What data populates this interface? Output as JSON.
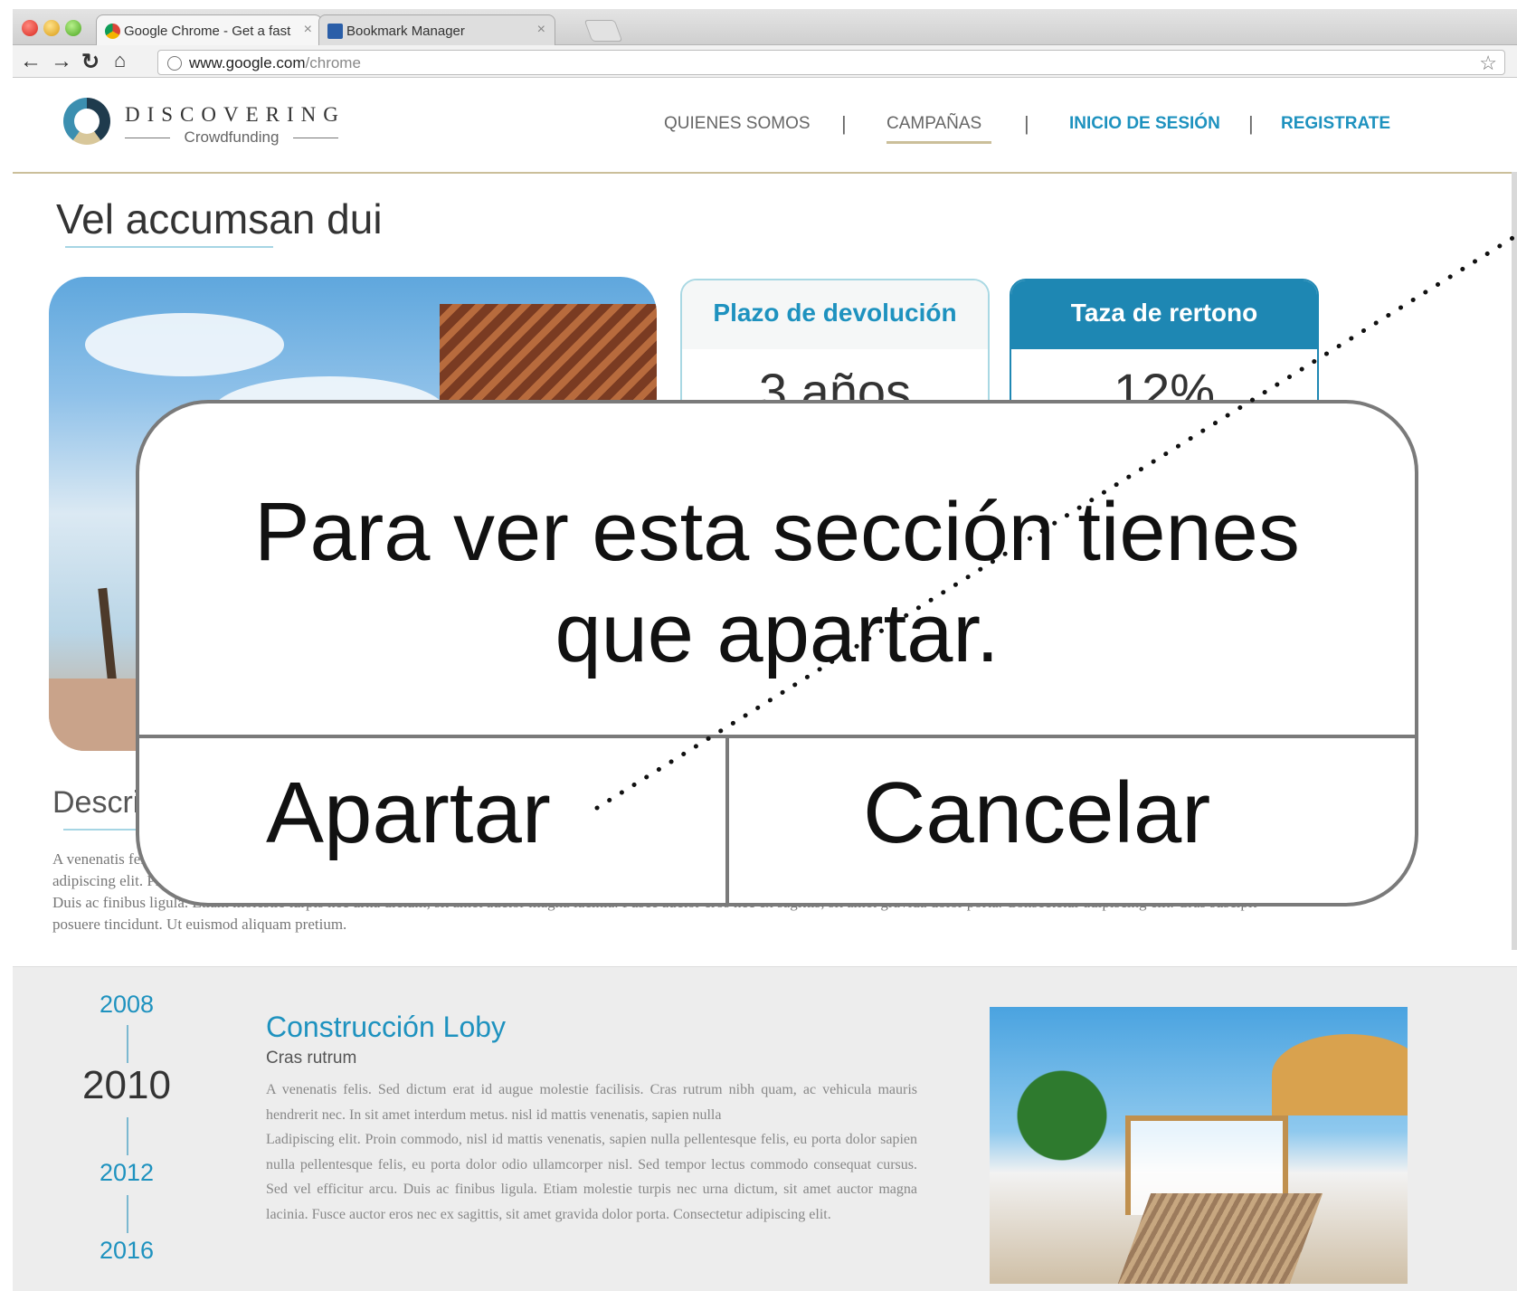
{
  "browser": {
    "tabs": [
      {
        "label": "Google Chrome - Get a fast",
        "active": true
      },
      {
        "label": "Bookmark Manager",
        "active": false
      }
    ],
    "url_host": "www.google.com",
    "url_path": "/chrome",
    "icons": {
      "back": "back-arrow-icon",
      "forward": "forward-arrow-icon",
      "reload": "reload-icon",
      "home": "home-icon",
      "bookmark": "star-icon"
    }
  },
  "header": {
    "logo_title": "DISCOVERING",
    "logo_subtitle": "Crowdfunding",
    "nav": {
      "quienes": "QUIENES SOMOS",
      "campanas": "CAMPAÑAS",
      "inicio": "INICIO DE SESIÓN",
      "registrate": "REGISTRATE"
    },
    "separator": "|"
  },
  "main": {
    "title": "Vel accumsan dui",
    "cards": {
      "plazo_title": "Plazo de devolución",
      "plazo_value": "3 años",
      "taza_title": "Taza de rertono",
      "taza_value": "12%"
    },
    "description_title": "Descripción",
    "description_text": "A venenatis felis. Sed dictum erat id augue molestie facilisis. Cras rutrum nibh quam, ac vehicula mauris hendrerit nec. In sit amet interdum metus. Lorem ipsum dolor sit amet, consectetur adipiscing elit. Proin commodo, nisl id mattis venenatis, sapien nulla pellentesque felis, eu porta dolor odio ullamcorper nisl. Sed tempor lectus commodo consequat cursus. Sed vel efficitur arcu. Duis ac finibus ligula. Etiam molestie turpis nec urna dictum, sit amet auctor magna lacinia. Fusce auctor eros nec ex sagittis, sit amet gravida dolor porta. Consectetur adipiscing elit. Cras suscipit posuere tincidunt. Ut euismod aliquam pretium."
  },
  "timeline": {
    "years": [
      "2008",
      "2010",
      "2012",
      "2016"
    ],
    "event_title": "Construcción Loby",
    "event_subtitle": "Cras rutrum",
    "event_text_1": "A venenatis felis. Sed dictum erat id augue molestie facilisis. Cras rutrum nibh quam, ac vehicula mauris hendrerit nec. In sit amet interdum metus. nisl id mattis venenatis, sapien nulla",
    "event_text_2": "Ladipiscing elit. Proin commodo, nisl id mattis venenatis, sapien nulla pellentesque felis, eu porta dolor sapien nulla pellentesque felis, eu porta dolor odio ullamcorper nisl. Sed tempor lectus commodo consequat cursus. Sed vel efficitur arcu. Duis ac finibus ligula. Etiam molestie turpis nec urna dictum, sit amet auctor magna lacinia. Fusce auctor eros nec ex sagittis, sit amet gravida dolor porta. Consectetur adipiscing elit."
  },
  "modal": {
    "message_line1": "Para ver esta sección tienes",
    "message_line2": "que apartar.",
    "confirm_label": "Apartar",
    "cancel_label": "Cancelar"
  },
  "colors": {
    "accent_blue": "#1e92bf",
    "gold": "#cbbf9a",
    "modal_border": "#7a7a7a"
  }
}
